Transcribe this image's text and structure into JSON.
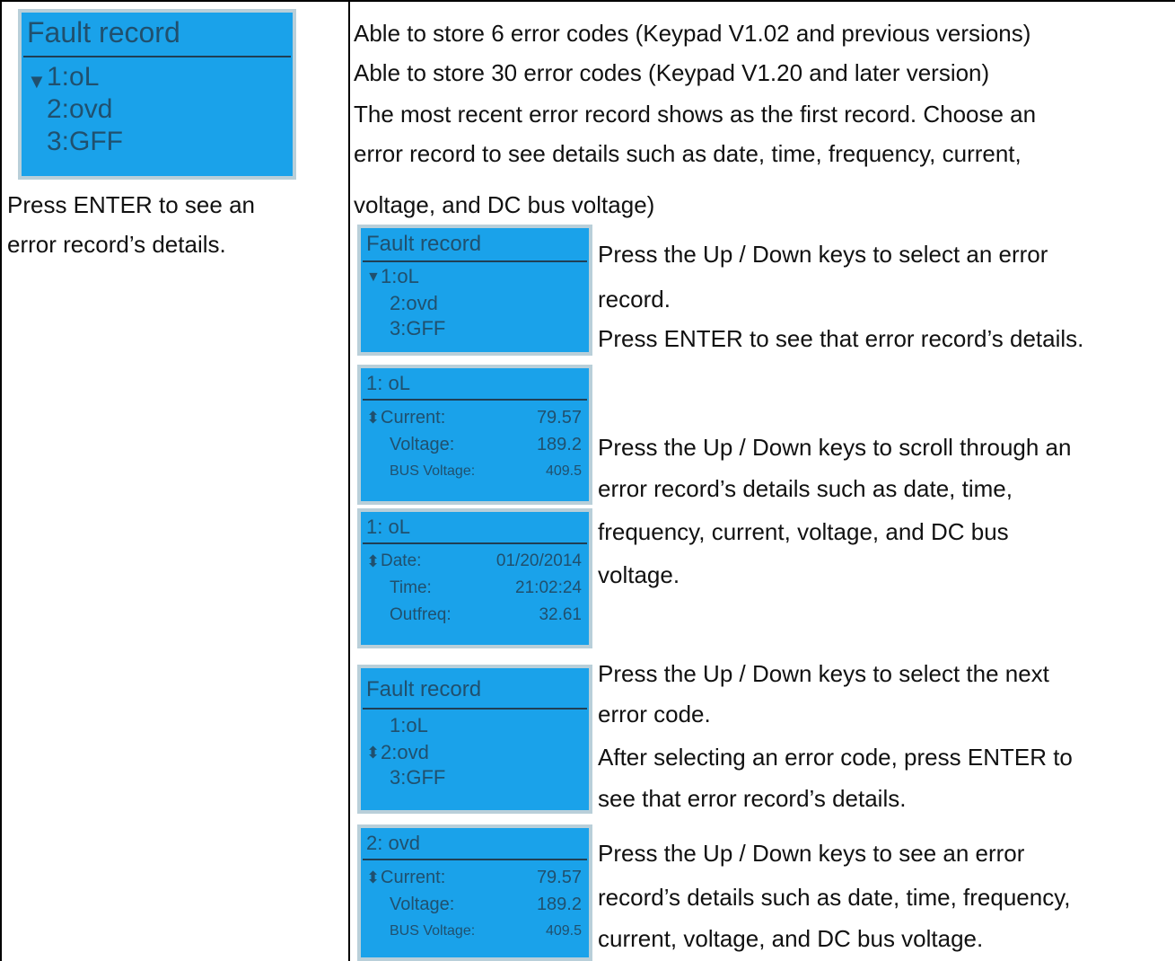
{
  "left": {
    "screen": {
      "title": "Fault record",
      "marker": "▼",
      "items": [
        "1:oL",
        "2:ovd",
        "3:GFF"
      ]
    },
    "caption": [
      "Press ENTER to see an",
      "error record’s details."
    ]
  },
  "intro": [
    "Able to store 6 error codes (Keypad V1.02 and previous versions)",
    "Able to store 30 error codes (Keypad V1.20 and later version)",
    "The most recent error record shows as the first record. Choose an",
    "error record to see details such as date, time, frequency, current,",
    "voltage, and DC bus voltage)"
  ],
  "screens": {
    "s1": {
      "title": "Fault record",
      "marker": "▼",
      "items": [
        "1:oL",
        "2:ovd",
        "3:GFF"
      ]
    },
    "s2": {
      "title": "1: oL",
      "marker": "⬍",
      "rows": [
        {
          "label": "Current:",
          "value": "79.57"
        },
        {
          "label": "Voltage:",
          "value": "189.2"
        },
        {
          "label": "BUS Voltage:",
          "value": "409.5"
        }
      ]
    },
    "s3": {
      "title": "1: oL",
      "marker": "⬍",
      "rows": [
        {
          "label": "Date:",
          "value": "01/20/2014"
        },
        {
          "label": "Time:",
          "value": "21:02:24"
        },
        {
          "label": "Outfreq:",
          "value": "32.61"
        }
      ]
    },
    "s4": {
      "title": "Fault record",
      "marker": "⬍",
      "items": [
        "1:oL",
        "2:ovd",
        "3:GFF"
      ]
    },
    "s5": {
      "title": "2: ovd",
      "marker": "⬍",
      "rows": [
        {
          "label": "Current:",
          "value": "79.57"
        },
        {
          "label": "Voltage:",
          "value": "189.2"
        },
        {
          "label": "BUS Voltage:",
          "value": "409.5"
        }
      ]
    }
  },
  "desc": {
    "d1": [
      "Press the Up / Down keys to select an error",
      "record.",
      "Press ENTER to see that error record’s details."
    ],
    "d2": [
      "Press the Up / Down keys to scroll through an",
      "error record’s details such as date, time,",
      "frequency, current, voltage, and DC bus",
      "voltage."
    ],
    "d3": [
      "Press the Up / Down keys to select the next",
      "error code.",
      "After selecting an error code, press ENTER to",
      "see that error record’s details."
    ],
    "d4": [
      "Press the Up / Down keys to see an error",
      "record’s details such as date, time, frequency,",
      "current, voltage, and DC bus voltage."
    ]
  },
  "colors": {
    "lcd_background": "#1aa2ea",
    "lcd_text": "#20506e",
    "rule": "#000000"
  }
}
